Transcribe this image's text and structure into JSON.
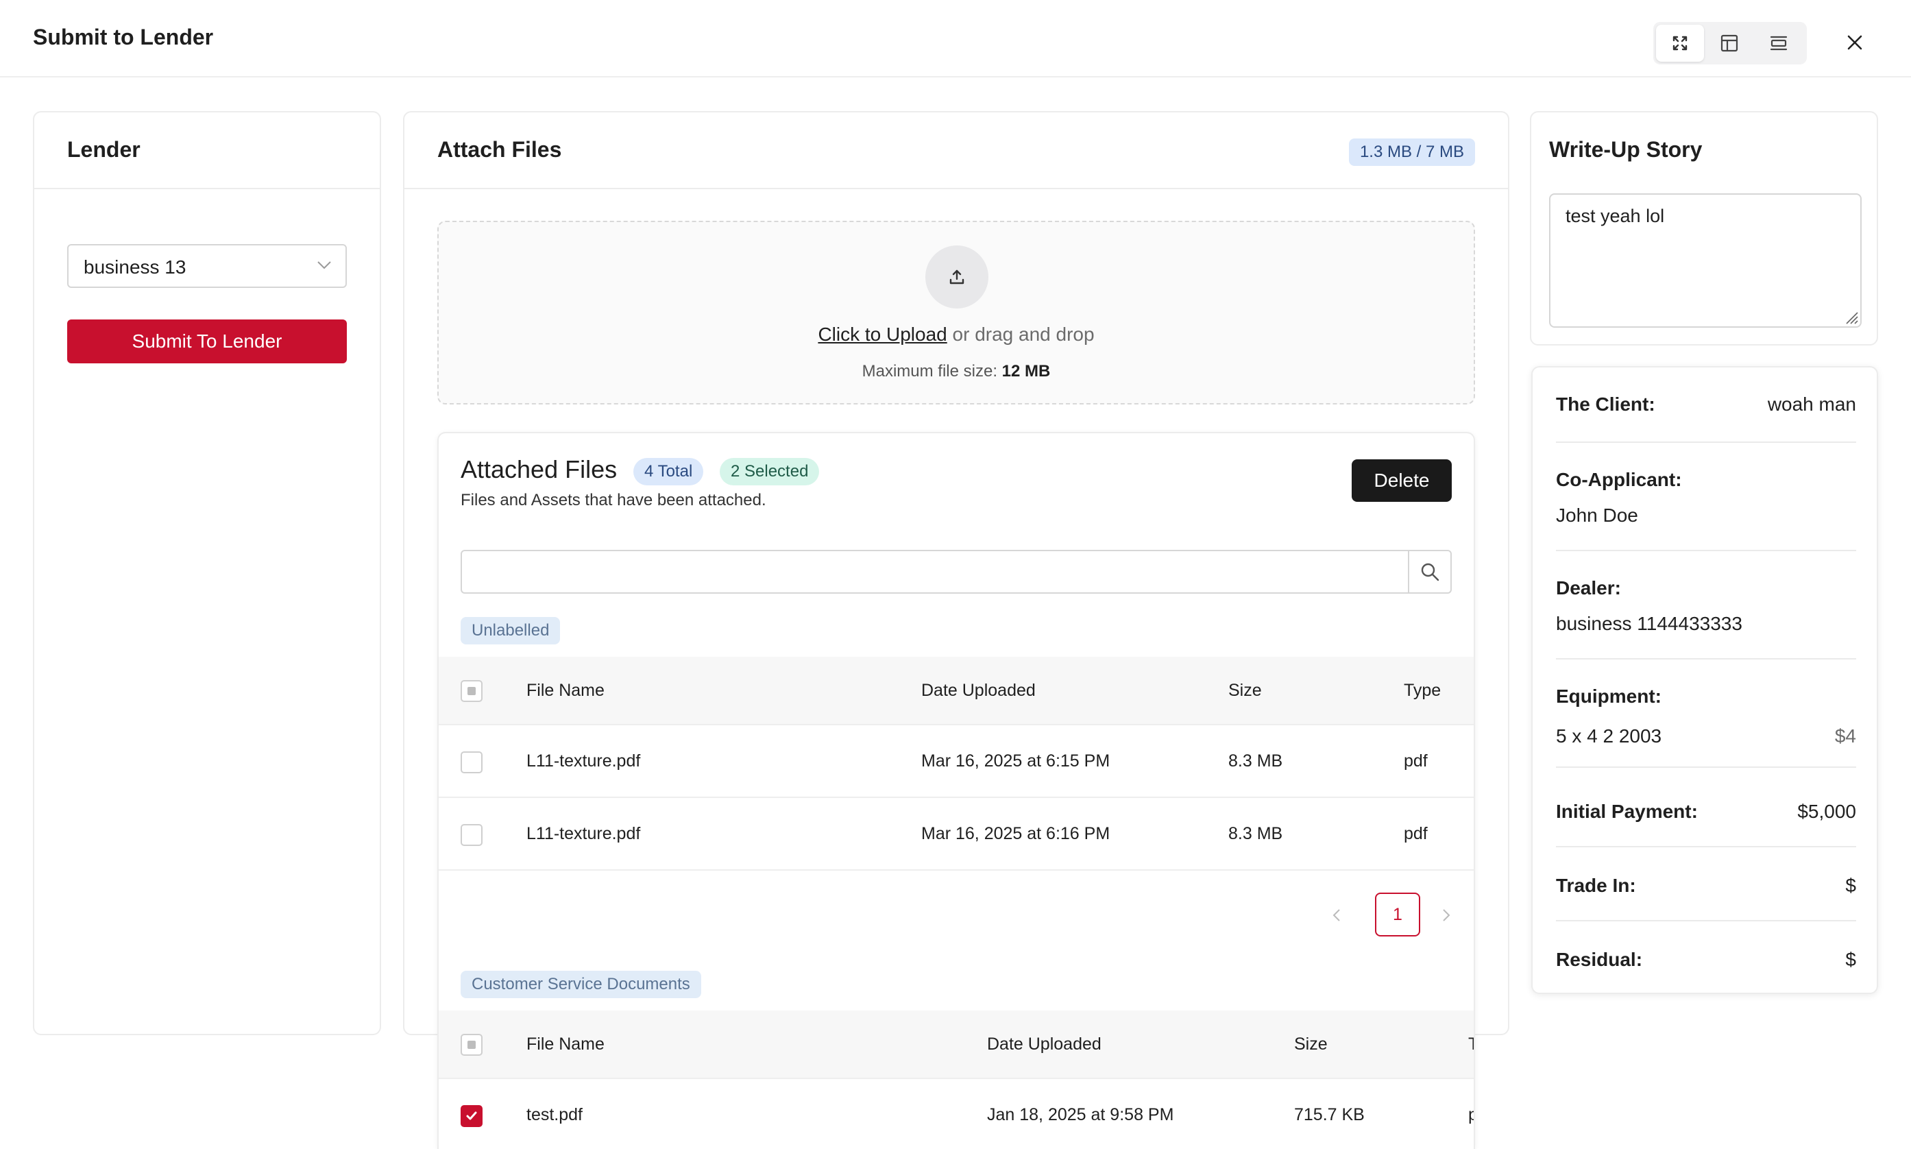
{
  "header": {
    "title": "Submit to Lender",
    "view_buttons": [
      "fullscreen-icon",
      "split-layout-icon",
      "stacked-layout-icon"
    ]
  },
  "lender": {
    "title": "Lender",
    "selected": "business 13",
    "submit_label": "Submit To Lender"
  },
  "attach": {
    "title": "Attach Files",
    "size_usage": "1.3 MB / 7 MB",
    "upload_link": "Click to Upload",
    "upload_rest": " or drag and drop",
    "max_label": "Maximum file size: ",
    "max_value": "12 MB"
  },
  "files": {
    "title": "Attached Files",
    "total_badge": "4 Total",
    "selected_badge": "2 Selected",
    "subtitle": "Files and Assets that have been attached.",
    "delete_label": "Delete",
    "search_placeholder": ""
  },
  "groups": [
    {
      "label": "Unlabelled",
      "columns": [
        "File Name",
        "Date Uploaded",
        "Size",
        "Type"
      ],
      "rows": [
        {
          "name": "L11-texture.pdf",
          "date": "Mar 16, 2025 at 6:15 PM",
          "size": "8.3 MB",
          "type": "pdf",
          "checked": false
        },
        {
          "name": "L11-texture.pdf",
          "date": "Mar 16, 2025 at 6:16 PM",
          "size": "8.3 MB",
          "type": "pdf",
          "checked": false
        }
      ],
      "page": "1"
    },
    {
      "label": "Customer Service Documents",
      "columns": [
        "File Name",
        "Date Uploaded",
        "Size",
        "T"
      ],
      "rows": [
        {
          "name": "test.pdf",
          "date": "Jan 18, 2025 at 9:58 PM",
          "size": "715.7 KB",
          "type": "p",
          "checked": true
        }
      ]
    }
  ],
  "story": {
    "title": "Write-Up Story",
    "text": "test yeah lol"
  },
  "summary": {
    "client_label": "The Client:",
    "client_value": "woah man",
    "coapplicant_label": "Co-Applicant:",
    "coapplicant_value": "John Doe",
    "dealer_label": "Dealer:",
    "dealer_value": "business 1144433333",
    "equipment_label": "Equipment:",
    "equipment_name": "5 x 4 2 2003",
    "equipment_price": "$4",
    "initial_label": "Initial Payment:",
    "initial_value": "$5,000",
    "trade_label": "Trade In:",
    "trade_value": "$",
    "residual_label": "Residual:",
    "residual_value": "$"
  },
  "colors": {
    "accent": "#c8102e",
    "dark_button": "#1a1a1a",
    "total_badge_bg": "#dbe8fb",
    "selected_badge_bg": "#d6f5ea"
  }
}
